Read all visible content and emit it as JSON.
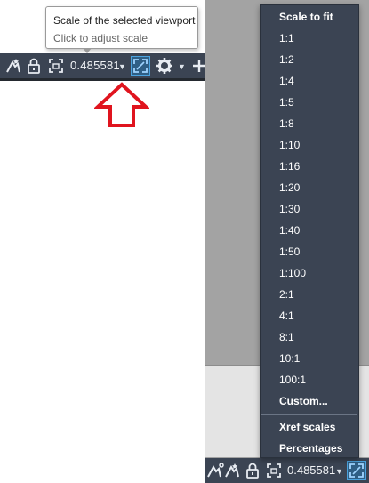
{
  "left": {
    "tooltip": {
      "title": "Scale of the selected viewport",
      "description": "Click to adjust scale"
    },
    "statusbar": {
      "scale_value": "0.485581",
      "icons": [
        "annotation-visibility-icon",
        "lock-icon",
        "maximize-viewport-icon",
        "scale-selected-viewport-icon",
        "gear-icon",
        "plus-icon"
      ]
    },
    "arrow_color": "#e0141e"
  },
  "menu": {
    "items": [
      {
        "label": "Scale to fit",
        "bold": true
      },
      {
        "label": "1:1"
      },
      {
        "label": "1:2"
      },
      {
        "label": "1:4"
      },
      {
        "label": "1:5"
      },
      {
        "label": "1:8"
      },
      {
        "label": "1:10"
      },
      {
        "label": "1:16"
      },
      {
        "label": "1:20"
      },
      {
        "label": "1:30"
      },
      {
        "label": "1:40"
      },
      {
        "label": "1:50"
      },
      {
        "label": "1:100"
      },
      {
        "label": "2:1"
      },
      {
        "label": "4:1"
      },
      {
        "label": "8:1"
      },
      {
        "label": "10:1"
      },
      {
        "label": "100:1"
      },
      {
        "label": "Custom...",
        "bold": true
      }
    ],
    "extra_items": [
      {
        "label": "Xref scales",
        "bold": true
      },
      {
        "label": "Percentages",
        "bold": true
      }
    ]
  },
  "right_statusbar": {
    "scale_value": "0.485581"
  },
  "colors": {
    "statusbar_bg": "#3b4453",
    "menu_bg": "#3b4453",
    "highlight_blue": "#4aa3df"
  }
}
